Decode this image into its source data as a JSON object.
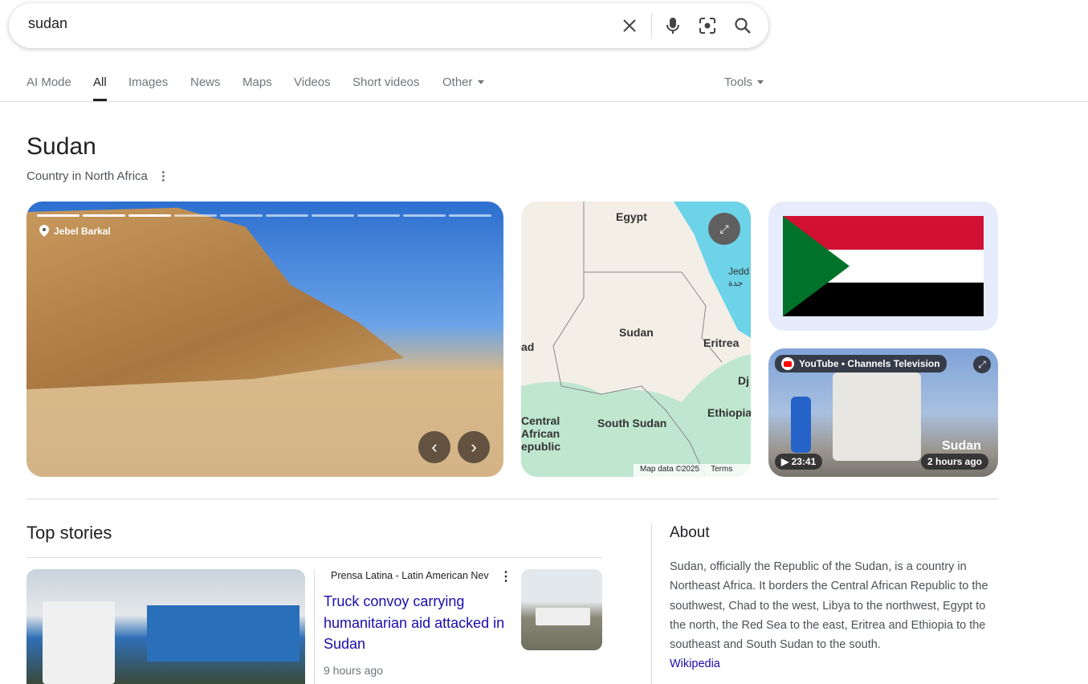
{
  "search": {
    "query": "sudan"
  },
  "tabs": [
    {
      "label": "AI Mode"
    },
    {
      "label": "All"
    },
    {
      "label": "Images"
    },
    {
      "label": "News"
    },
    {
      "label": "Maps"
    },
    {
      "label": "Videos"
    },
    {
      "label": "Short videos"
    },
    {
      "label": "Other"
    }
  ],
  "tools_label": "Tools",
  "entity": {
    "title": "Sudan",
    "subtitle": "Country in North Africa"
  },
  "photo": {
    "location": "Jebel Barkal",
    "total_slides": 10,
    "current_slide": 3
  },
  "map": {
    "labels": {
      "egypt": "Egypt",
      "jeddah": "Jedd",
      "jeddah_ar": "جدة",
      "sudan": "Sudan",
      "chad": "ad",
      "eritrea": "Eritrea",
      "djibouti": "Dj",
      "car1": "Central",
      "car2": "African",
      "car3": "epublic",
      "south_sudan": "South Sudan",
      "ethiopia": "Ethiopia"
    },
    "attribution": "Map data ©2025",
    "terms": "Terms"
  },
  "flag": {
    "colors": {
      "red": "#d21034",
      "white": "#ffffff",
      "black": "#000000",
      "green": "#007229"
    }
  },
  "video": {
    "source": "YouTube • Channels Television",
    "duration": "23:41",
    "age": "2 hours ago",
    "overlay_text": "Sudan"
  },
  "top_stories": {
    "heading": "Top stories",
    "items": [
      {
        "source": "Prensa Latina - Latin American Nev",
        "title": "Truck convoy carrying humanitarian aid attacked in Sudan",
        "time": "9 hours ago"
      }
    ]
  },
  "about": {
    "heading": "About",
    "text": "Sudan, officially the Republic of the Sudan, is a country in Northeast Africa. It borders the Central African Republic to the southwest, Chad to the west, Libya to the northwest, Egypt to the north, the Red Sea to the east, Eritrea and Ethiopia to the southeast and South Sudan to the south.",
    "link": "Wikipedia"
  }
}
